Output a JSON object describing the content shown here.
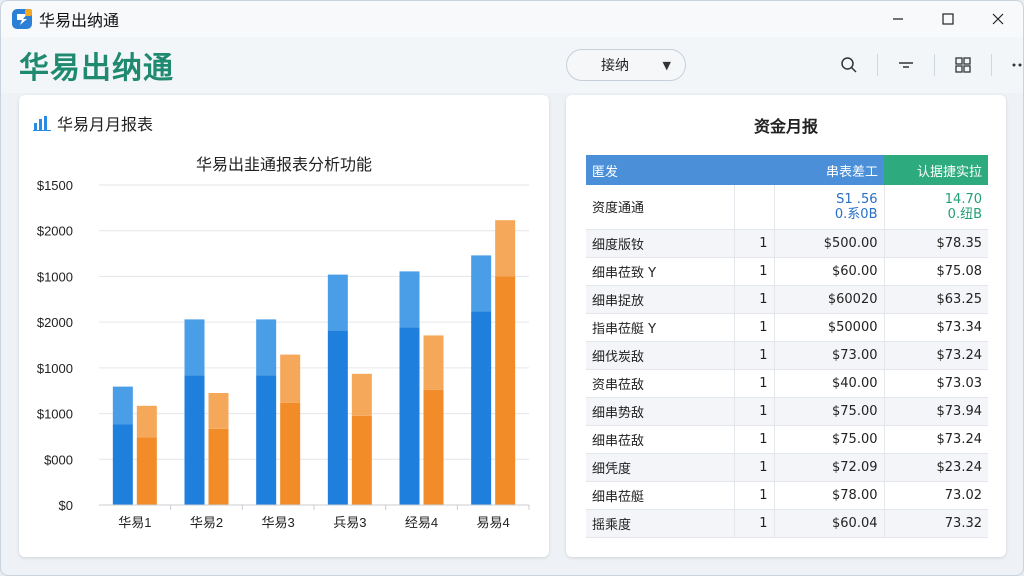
{
  "window": {
    "title": "华易出纳通",
    "controls": [
      "minimize",
      "maximize",
      "close"
    ]
  },
  "toolbar": {
    "brand": "华易出纳通",
    "select_value": "接纳",
    "icons": [
      "search-icon",
      "filter-icon",
      "grid-icon",
      "more-icon"
    ]
  },
  "left_panel": {
    "header": "华易月月报表",
    "chart_title": "华易出韭通报表分析功能"
  },
  "chart_data": {
    "type": "bar",
    "title": "华易出韭通报表分析功能",
    "ytick_labels": [
      "$1500",
      "$2000",
      "$1000",
      "$2000",
      "$1000",
      "$1000",
      "$000",
      "$0"
    ],
    "categories": [
      "华易1",
      "华易2",
      "华易3",
      "兵易3",
      "经易4",
      "易易4"
    ],
    "series": [
      {
        "color": "#2a8be0",
        "values": [
          37,
          58,
          58,
          72,
          73,
          78
        ]
      },
      {
        "color": "#f08c2a",
        "values": [
          31,
          35,
          47,
          41,
          53,
          89
        ]
      }
    ],
    "ylim": [
      0,
      100
    ],
    "grid": true
  },
  "right_panel": {
    "title": "资金月报",
    "columns": [
      "匿发",
      "",
      "串表差工",
      "认据捷实拉"
    ],
    "first_row": {
      "name": "资度通通",
      "qty": "",
      "v1a": "S1 .56",
      "v1b": "0.系0B",
      "v2a": "14.70",
      "v2b": "0.纽B"
    },
    "rows": [
      {
        "name": "细度版钕",
        "qty": "1",
        "v1": "$500.00",
        "v2": "$78.35"
      },
      {
        "name": "细串莅致 Y",
        "qty": "1",
        "v1": "$60.00",
        "v2": "$75.08"
      },
      {
        "name": "细串捉放",
        "qty": "1",
        "v1": "$60020",
        "v2": "$63.25"
      },
      {
        "name": "指串莅艇 Y",
        "qty": "1",
        "v1": "$50000",
        "v2": "$73.34"
      },
      {
        "name": "细伐炭敌",
        "qty": "1",
        "v1": "$73.00",
        "v2": "$73.24"
      },
      {
        "name": "资串莅敌",
        "qty": "1",
        "v1": "$40.00",
        "v2": "$73.03"
      },
      {
        "name": "细串势敌",
        "qty": "1",
        "v1": "$75.00",
        "v2": "$73.94"
      },
      {
        "name": "细串莅敌",
        "qty": "1",
        "v1": "$75.00",
        "v2": "$73.24"
      },
      {
        "name": "细凭度",
        "qty": "1",
        "v1": "$72.09",
        "v2": "$23.24"
      },
      {
        "name": "细串莅艇",
        "qty": "1",
        "v1": "$78.00",
        "v2": "73.02"
      },
      {
        "name": "摇乘度",
        "qty": "1",
        "v1": "$60.04",
        "v2": "73.32"
      }
    ]
  }
}
